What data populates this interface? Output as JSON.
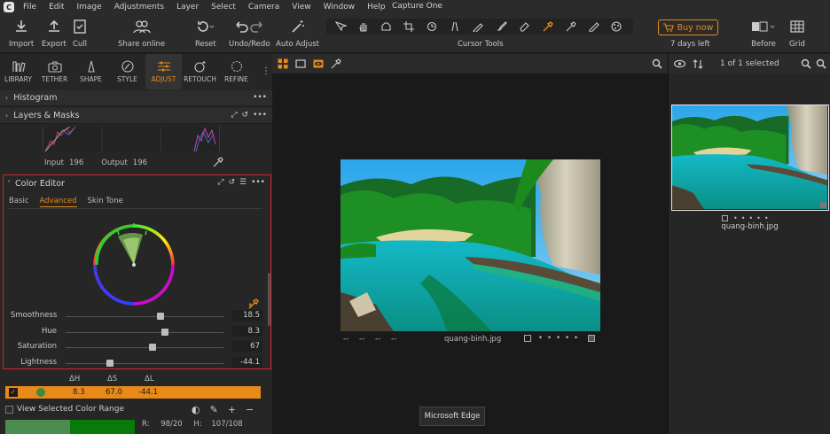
{
  "menubar": {
    "items": [
      "File",
      "Edit",
      "Image",
      "Adjustments",
      "Layer",
      "Select",
      "Camera",
      "View",
      "Window",
      "Help"
    ],
    "app_title": "Capture One"
  },
  "toolbar": {
    "import": "Import",
    "export": "Export",
    "cull": "Cull",
    "share_online": "Share online",
    "reset": "Reset",
    "undo_redo": "Undo/Redo",
    "auto_adjust": "Auto Adjust",
    "cursor_tools": "Cursor Tools",
    "buy_now": "Buy now",
    "days_left": "7 days left",
    "before": "Before",
    "grid": "Grid"
  },
  "tool_tabs": [
    {
      "label": "LIBRARY",
      "icon": "library-icon"
    },
    {
      "label": "TETHER",
      "icon": "camera-icon"
    },
    {
      "label": "SHAPE",
      "icon": "shape-icon"
    },
    {
      "label": "STYLE",
      "icon": "style-icon"
    },
    {
      "label": "ADJUST",
      "icon": "adjust-sliders-icon"
    },
    {
      "label": "RETOUCH",
      "icon": "retouch-icon"
    },
    {
      "label": "REFINE",
      "icon": "refine-icon"
    }
  ],
  "sections": {
    "histogram": "Histogram",
    "layers": "Layers & Masks"
  },
  "levels": {
    "input_label": "Input",
    "input_value": "196",
    "output_label": "Output",
    "output_value": "196"
  },
  "color_editor": {
    "title": "Color Editor",
    "tabs": [
      "Basic",
      "Advanced",
      "Skin Tone"
    ],
    "active_tab": "Advanced",
    "sliders": [
      {
        "name": "Smoothness",
        "value": "18.5",
        "pos": 0.6
      },
      {
        "name": "Hue",
        "value": "8.3",
        "pos": 0.63
      },
      {
        "name": "Saturation",
        "value": "67",
        "pos": 0.55
      },
      {
        "name": "Lightness",
        "value": "-44.1",
        "pos": 0.28
      }
    ],
    "delta_headers": [
      "ΔH",
      "ΔS",
      "ΔL"
    ],
    "delta_values": [
      "8.3",
      "67.0",
      "-44.1"
    ],
    "view_range_label": "View Selected Color Range",
    "readout": {
      "r": "R:",
      "r_val": "98/20",
      "h": "H:",
      "h_val": "107/108"
    }
  },
  "viewer": {
    "filename": "quang-binh.jpg",
    "meta_dashes": [
      "--",
      "--",
      "--",
      "--"
    ]
  },
  "browser": {
    "selection_count": "1 of 1 selected",
    "thumb_name": "quang-binh.jpg"
  },
  "tooltip": "Microsoft Edge",
  "colors": {
    "accent": "#e88a1a",
    "highlight_border": "#d6232a"
  }
}
